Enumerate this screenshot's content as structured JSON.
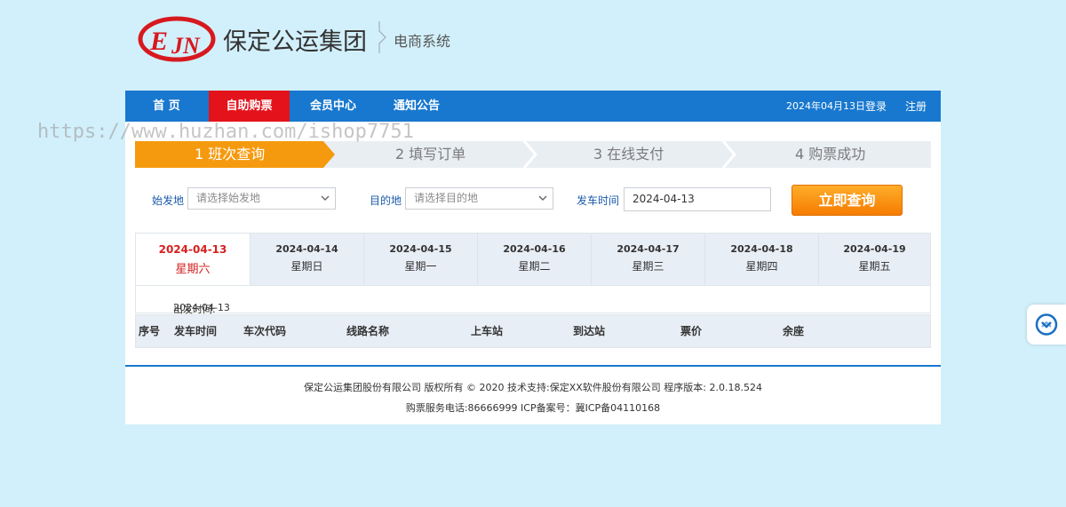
{
  "header": {
    "company_name": "保定公运集团",
    "subsystem": "电商系统",
    "logo_icon": "bus-company-logo",
    "logo_color": "#d7191f"
  },
  "nav": {
    "items": [
      {
        "label": "首 页",
        "active": false
      },
      {
        "label": "自助购票",
        "active": true
      },
      {
        "label": "会员中心",
        "active": false
      },
      {
        "label": "通知公告",
        "active": false
      }
    ],
    "date": "2024年04月13日",
    "login": "登录",
    "register": "注册",
    "bg_color": "#1878cf",
    "active_color": "#e4131b"
  },
  "watermark": "https://www.huzhan.com/ishop7751",
  "steps": [
    {
      "label": "1 班次查询",
      "active": true
    },
    {
      "label": "2 填写订单",
      "active": false
    },
    {
      "label": "3 在线支付",
      "active": false
    },
    {
      "label": "4 购票成功",
      "active": false
    }
  ],
  "search": {
    "origin_label": "始发地",
    "origin_placeholder": "请选择始发地",
    "destination_label": "目的地",
    "destination_placeholder": "请选择目的地",
    "date_label": "发车时间",
    "date_value": "2024-04-13",
    "button_label": "立即查询"
  },
  "date_tabs": [
    {
      "date": "2024-04-13",
      "weekday": "星期六",
      "active": true
    },
    {
      "date": "2024-04-14",
      "weekday": "星期日",
      "active": false
    },
    {
      "date": "2024-04-15",
      "weekday": "星期一",
      "active": false
    },
    {
      "date": "2024-04-16",
      "weekday": "星期二",
      "active": false
    },
    {
      "date": "2024-04-17",
      "weekday": "星期三",
      "active": false
    },
    {
      "date": "2024-04-18",
      "weekday": "星期四",
      "active": false
    },
    {
      "date": "2024-04-19",
      "weekday": "星期五",
      "active": false
    }
  ],
  "departure": {
    "label": "出发时间:",
    "value": "2024-04-13"
  },
  "table": {
    "headers": [
      "序号",
      "发车时间",
      "车次代码",
      "线路名称",
      "上车站",
      "到达站",
      "票价",
      "余座"
    ]
  },
  "footer": {
    "line1": "保定公运集团股份有限公司 版权所有 © 2020 技术支持:保定XX软件股份有限公司 程序版本: 2.0.18.524",
    "line2": "购票服务电话:86666999 ICP备案号：冀ICP备04110168"
  },
  "side_widget_icon": "customer-service-icon"
}
